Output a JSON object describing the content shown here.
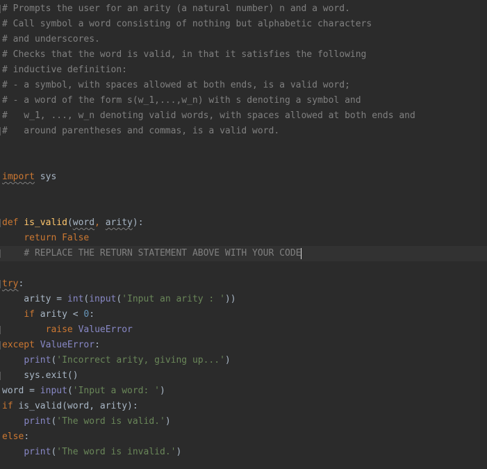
{
  "editor": {
    "language": "python",
    "lines": [
      {
        "n": 1,
        "tokens": [
          {
            "t": "comment",
            "v": "# Prompts the user for an arity (a natural number) n and a word."
          }
        ]
      },
      {
        "n": 2,
        "tokens": [
          {
            "t": "comment",
            "v": "# Call symbol a word consisting of nothing but alphabetic characters"
          }
        ]
      },
      {
        "n": 3,
        "tokens": [
          {
            "t": "comment",
            "v": "# and underscores."
          }
        ]
      },
      {
        "n": 4,
        "tokens": [
          {
            "t": "comment",
            "v": "# Checks that the word is valid, in that it satisfies the following"
          }
        ]
      },
      {
        "n": 5,
        "tokens": [
          {
            "t": "comment",
            "v": "# inductive definition:"
          }
        ]
      },
      {
        "n": 6,
        "tokens": [
          {
            "t": "comment",
            "v": "# - a symbol, with spaces allowed at both ends, is a valid word;"
          }
        ]
      },
      {
        "n": 7,
        "tokens": [
          {
            "t": "comment",
            "v": "# - a word of the form s(w_1,...,w_n) with s denoting a symbol and"
          }
        ]
      },
      {
        "n": 8,
        "tokens": [
          {
            "t": "comment",
            "v": "#   w_1, ..., w_n denoting valid words, with spaces allowed at both ends and"
          }
        ]
      },
      {
        "n": 9,
        "tokens": [
          {
            "t": "comment",
            "v": "#   around parentheses and commas, is a valid word."
          }
        ]
      },
      {
        "n": 10,
        "tokens": []
      },
      {
        "n": 11,
        "tokens": []
      },
      {
        "n": 12,
        "tokens": [
          {
            "t": "keyword",
            "v": "import",
            "warn": true
          },
          {
            "t": "plain",
            "v": " sys"
          }
        ]
      },
      {
        "n": 13,
        "tokens": []
      },
      {
        "n": 14,
        "tokens": []
      },
      {
        "n": 15,
        "tokens": [
          {
            "t": "keyword",
            "v": "def "
          },
          {
            "t": "func",
            "v": "is_valid"
          },
          {
            "t": "plain",
            "v": "("
          },
          {
            "t": "param",
            "v": "word",
            "warn": true
          },
          {
            "t": "punct",
            "v": ", "
          },
          {
            "t": "param",
            "v": "arity",
            "warn": true
          },
          {
            "t": "plain",
            "v": "):"
          }
        ]
      },
      {
        "n": 16,
        "tokens": [
          {
            "t": "plain",
            "v": "    "
          },
          {
            "t": "keyword",
            "v": "return False"
          }
        ]
      },
      {
        "n": 17,
        "current": true,
        "caret": true,
        "tokens": [
          {
            "t": "plain",
            "v": "    "
          },
          {
            "t": "comment",
            "v": "# REPLACE THE RETURN STATEMENT ABOVE WITH YOUR CODE"
          }
        ]
      },
      {
        "n": 18,
        "tokens": []
      },
      {
        "n": 19,
        "tokens": [
          {
            "t": "keyword",
            "v": "try",
            "warn": true
          },
          {
            "t": "plain",
            "v": ":"
          }
        ]
      },
      {
        "n": 20,
        "tokens": [
          {
            "t": "plain",
            "v": "    arity = "
          },
          {
            "t": "builtin",
            "v": "int"
          },
          {
            "t": "plain",
            "v": "("
          },
          {
            "t": "builtin",
            "v": "input"
          },
          {
            "t": "plain",
            "v": "("
          },
          {
            "t": "string",
            "v": "'Input an arity : '"
          },
          {
            "t": "plain",
            "v": "))"
          }
        ]
      },
      {
        "n": 21,
        "tokens": [
          {
            "t": "plain",
            "v": "    "
          },
          {
            "t": "keyword",
            "v": "if "
          },
          {
            "t": "plain",
            "v": "arity < "
          },
          {
            "t": "number",
            "v": "0"
          },
          {
            "t": "plain",
            "v": ":"
          }
        ]
      },
      {
        "n": 22,
        "tokens": [
          {
            "t": "plain",
            "v": "        "
          },
          {
            "t": "keyword",
            "v": "raise "
          },
          {
            "t": "builtin",
            "v": "ValueError"
          }
        ]
      },
      {
        "n": 23,
        "tokens": [
          {
            "t": "keyword",
            "v": "except "
          },
          {
            "t": "builtin",
            "v": "ValueError"
          },
          {
            "t": "plain",
            "v": ":"
          }
        ]
      },
      {
        "n": 24,
        "tokens": [
          {
            "t": "plain",
            "v": "    "
          },
          {
            "t": "builtin",
            "v": "print"
          },
          {
            "t": "plain",
            "v": "("
          },
          {
            "t": "string",
            "v": "'Incorrect arity, giving up...'"
          },
          {
            "t": "plain",
            "v": ")"
          }
        ]
      },
      {
        "n": 25,
        "tokens": [
          {
            "t": "plain",
            "v": "    sys.exit()"
          }
        ]
      },
      {
        "n": 26,
        "tokens": [
          {
            "t": "plain",
            "v": "word = "
          },
          {
            "t": "builtin",
            "v": "input"
          },
          {
            "t": "plain",
            "v": "("
          },
          {
            "t": "string",
            "v": "'Input a word: '"
          },
          {
            "t": "plain",
            "v": ")"
          }
        ]
      },
      {
        "n": 27,
        "tokens": [
          {
            "t": "keyword",
            "v": "if "
          },
          {
            "t": "plain",
            "v": "is_valid(word, arity):"
          }
        ]
      },
      {
        "n": 28,
        "tokens": [
          {
            "t": "plain",
            "v": "    "
          },
          {
            "t": "builtin",
            "v": "print"
          },
          {
            "t": "plain",
            "v": "("
          },
          {
            "t": "string",
            "v": "'The word is valid.'"
          },
          {
            "t": "plain",
            "v": ")"
          }
        ]
      },
      {
        "n": 29,
        "tokens": [
          {
            "t": "keyword",
            "v": "else"
          },
          {
            "t": "plain",
            "v": ":"
          }
        ]
      },
      {
        "n": 30,
        "tokens": [
          {
            "t": "plain",
            "v": "    "
          },
          {
            "t": "builtin",
            "v": "print"
          },
          {
            "t": "plain",
            "v": "("
          },
          {
            "t": "string",
            "v": "'The word is invalid.'"
          },
          {
            "t": "plain",
            "v": ")"
          }
        ]
      }
    ],
    "fold_marker_lines": [
      1,
      9,
      15,
      17,
      19,
      22,
      23,
      25
    ]
  }
}
